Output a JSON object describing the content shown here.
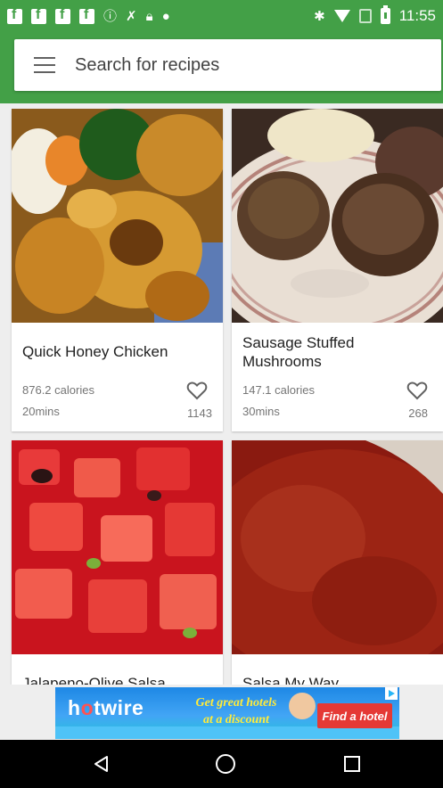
{
  "status_bar": {
    "time": "11:55",
    "left_icons": [
      "facebook-icon",
      "facebook-icon",
      "facebook-icon",
      "facebook-icon",
      "info-icon",
      "no-signal-tool-icon",
      "lock-icon",
      "android-icon"
    ],
    "right_icons": [
      "bluetooth-icon",
      "wifi-icon",
      "sim-icon",
      "battery-icon"
    ],
    "color": "#43a047"
  },
  "search": {
    "placeholder": "Search for recipes",
    "menu_icon": "hamburger-menu-icon"
  },
  "recipes": [
    {
      "title": "Quick Honey Chicken",
      "calories": "876.2 calories",
      "time": "20mins",
      "likes": "1143"
    },
    {
      "title": "Sausage Stuffed Mushrooms",
      "calories": "147.1 calories",
      "time": "30mins",
      "likes": "268"
    },
    {
      "title": "Jalapeno-Olive Salsa"
    },
    {
      "title": "Salsa My Way"
    }
  ],
  "ad": {
    "brand_prefix": "h",
    "brand_o": "o",
    "brand_suffix": "twire",
    "line1": "Get great hotels",
    "line2": "at a discount",
    "cta": "Find a hotel"
  },
  "nav": {
    "back_icon": "back-triangle-icon",
    "home_icon": "home-circle-icon",
    "recents_icon": "recents-square-icon"
  }
}
